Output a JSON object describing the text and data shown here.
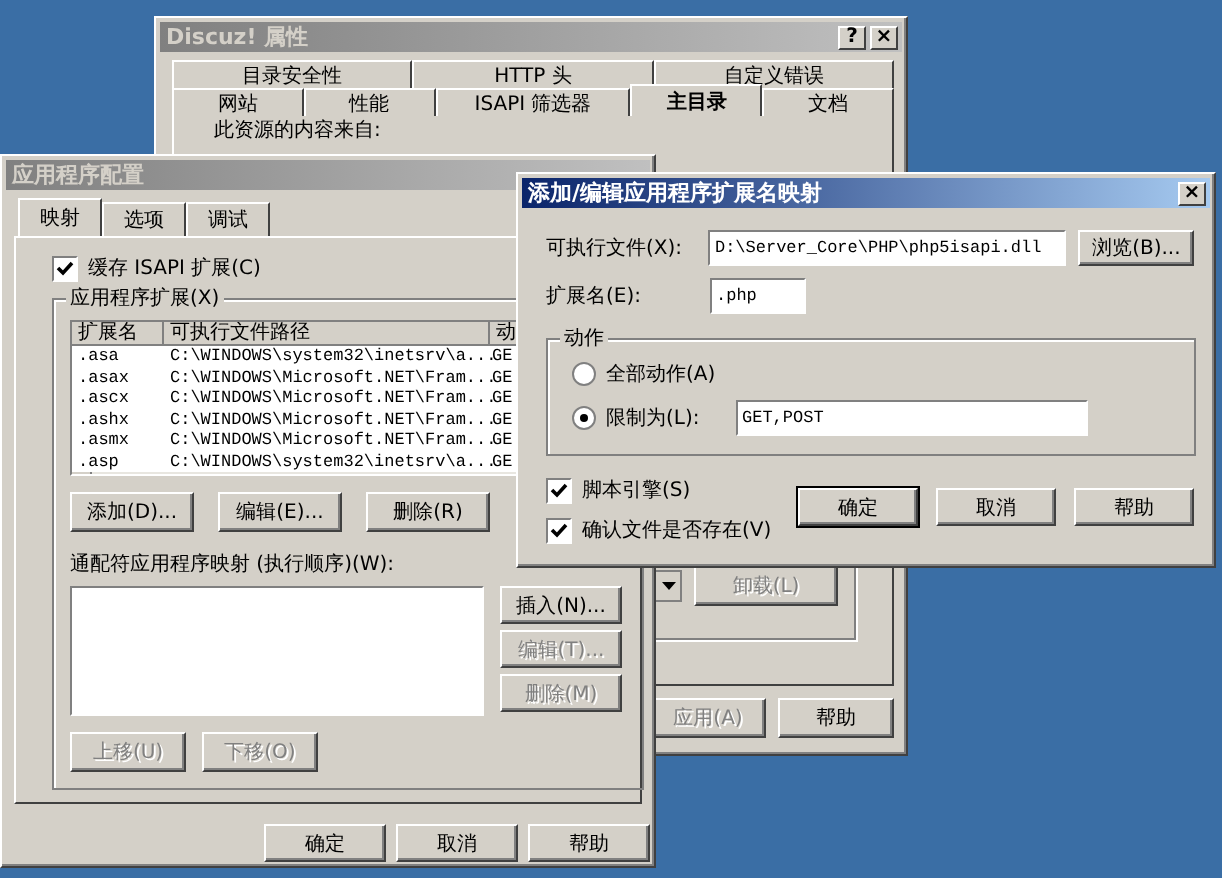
{
  "properties_window": {
    "title": "Discuz! 属性",
    "active": false,
    "title_buttons": [
      "?",
      "×"
    ],
    "tab_rows": [
      [
        {
          "label": "目录安全性",
          "selected": false
        },
        {
          "label": "HTTP 头",
          "selected": false
        },
        {
          "label": "自定义错误",
          "selected": false
        }
      ],
      [
        {
          "label": "网站",
          "selected": false
        },
        {
          "label": "性能",
          "selected": false
        },
        {
          "label": "ISAPI 筛选器",
          "selected": false
        },
        {
          "label": "主目录",
          "selected": true
        },
        {
          "label": "文档",
          "selected": false
        }
      ]
    ],
    "content_label": "此资源的内容来自:",
    "unload_button": {
      "label": "卸载(L)",
      "disabled": true
    },
    "buttons": [
      {
        "label": "应用(A)",
        "disabled": true
      },
      {
        "label": "帮助",
        "disabled": false
      }
    ]
  },
  "config_window": {
    "title": "应用程序配置",
    "active": false,
    "tabs": [
      {
        "label": "映射",
        "selected": true
      },
      {
        "label": "选项",
        "selected": false
      },
      {
        "label": "调试",
        "selected": false
      }
    ],
    "cache_checkbox": {
      "label": "缓存 ISAPI 扩展(C)",
      "checked": true
    },
    "extensions_group": {
      "title": "应用程序扩展(X)",
      "columns": [
        "扩展名",
        "可执行文件路径",
        "动"
      ],
      "rows": [
        [
          ".asa",
          "C:\\WINDOWS\\system32\\inetsrv\\a...",
          "GE"
        ],
        [
          ".asax",
          "C:\\WINDOWS\\Microsoft.NET\\Fram...",
          "GE"
        ],
        [
          ".ascx",
          "C:\\WINDOWS\\Microsoft.NET\\Fram...",
          "GE"
        ],
        [
          ".ashx",
          "C:\\WINDOWS\\Microsoft.NET\\Fram...",
          "GE"
        ],
        [
          ".asmx",
          "C:\\WINDOWS\\Microsoft.NET\\Fram...",
          "GE"
        ],
        [
          ".asp",
          "C:\\WINDOWS\\system32\\inetsrv\\a...",
          "GE"
        ]
      ],
      "buttons": [
        {
          "label": "添加(D)...",
          "disabled": false
        },
        {
          "label": "编辑(E)...",
          "disabled": false
        },
        {
          "label": "删除(R)",
          "disabled": false
        }
      ],
      "wildcard_label": "通配符应用程序映射 (执行顺序)(W):",
      "wildcard_buttons": [
        {
          "label": "插入(N)...",
          "disabled": false
        },
        {
          "label": "编辑(T)...",
          "disabled": true
        },
        {
          "label": "删除(M)",
          "disabled": true
        }
      ],
      "move_buttons": [
        {
          "label": "上移(U)",
          "disabled": true
        },
        {
          "label": "下移(O)",
          "disabled": true
        }
      ]
    },
    "buttons": [
      "确定",
      "取消",
      "帮助"
    ]
  },
  "mapping_dialog": {
    "title": "添加/编辑应用程序扩展名映射",
    "active": true,
    "close_button": "×",
    "executable": {
      "label": "可执行文件(X):",
      "value": "D:\\Server_Core\\PHP\\php5isapi.dll"
    },
    "browse_button": "浏览(B)...",
    "extension": {
      "label": "扩展名(E):",
      "value": ".php"
    },
    "verbs_group": {
      "title": "动作",
      "options": [
        {
          "label": "全部动作(A)",
          "selected": false
        },
        {
          "label": "限制为(L):",
          "selected": true,
          "value": "GET,POST"
        }
      ]
    },
    "checkboxes": [
      {
        "label": "脚本引擎(S)",
        "checked": true
      },
      {
        "label": "确认文件是否存在(V)",
        "checked": true
      }
    ],
    "buttons": [
      {
        "label": "确定",
        "default": true
      },
      {
        "label": "取消",
        "default": false
      },
      {
        "label": "帮助",
        "default": false
      }
    ]
  }
}
